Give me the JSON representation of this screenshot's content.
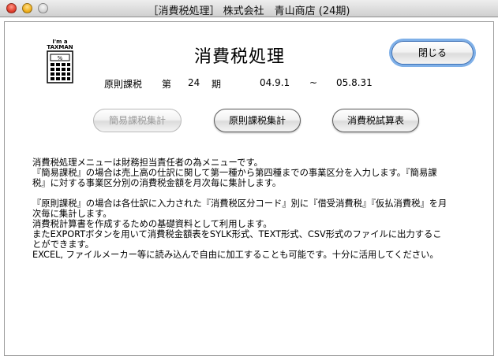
{
  "window": {
    "title": "［消費税処理］ 株式会社　青山商店 (24期)"
  },
  "logo": {
    "line1": "I'm a",
    "line2": "TAXMAN"
  },
  "header": {
    "title": "消費税処理"
  },
  "buttons": {
    "close": "閉じる",
    "kani": "簡易課税集計",
    "gensoku": "原則課税集計",
    "shisan": "消費税試算表"
  },
  "info": {
    "method": "原則課税",
    "term_label": "第",
    "term_no": "24",
    "term_unit": "期",
    "start": "04.9.1",
    "tilde": "~",
    "end": "05.8.31"
  },
  "description": {
    "lines": [
      "消費税処理メニューは財務担当責任者の為メニューです。",
      "『簡易課税』の場合は売上高の仕訳に関して第一種から第四種までの事業区分を入力します。『簡易課",
      "税』に対する事業区分別の消費税金額を月次毎に集計します。",
      "",
      "『原則課税』の場合は各仕訳に入力された『消費税区分コード』別に『借受消費税』『仮払消費税』を月",
      "次毎に集計します。",
      "消費税計算書を作成するための基礎資料として利用します。",
      "またEXPORTボタンを用いて消費税金額表をSYLK形式、TEXT形式、CSV形式のファイルに出力するこ",
      "とができます。",
      "EXCEL, ファイルメーカー等に読み込んで自由に加工することも可能です。十分に活用してください。"
    ]
  }
}
